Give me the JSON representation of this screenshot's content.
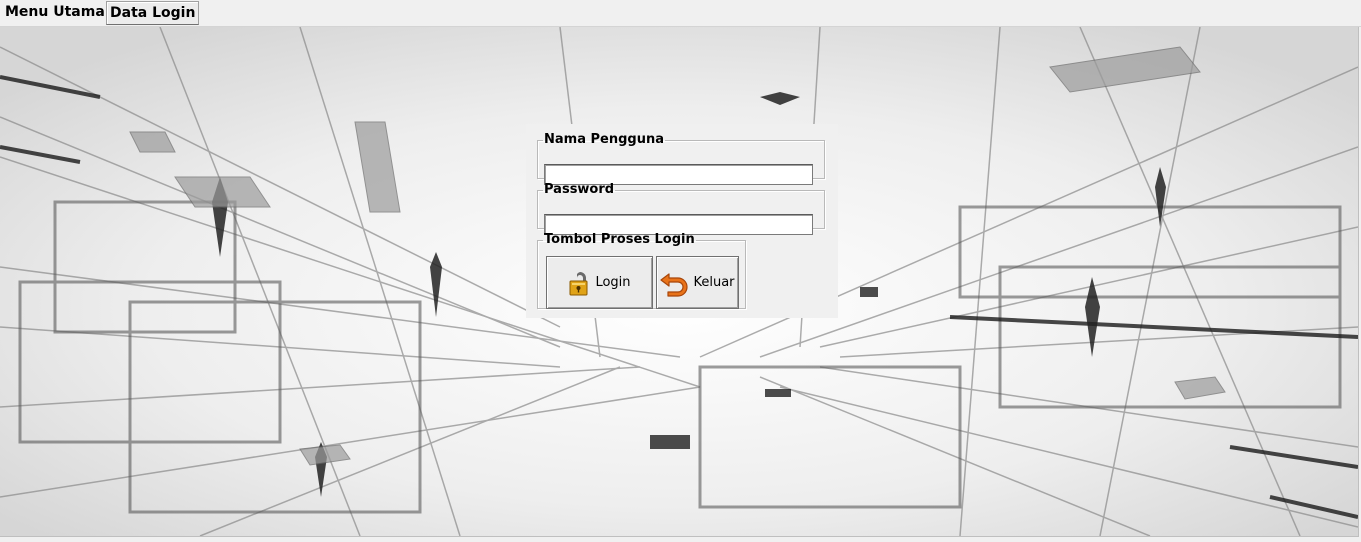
{
  "menu": {
    "items": [
      {
        "label": "Menu Utama"
      },
      {
        "label": "Data Login"
      }
    ]
  },
  "login": {
    "username_group": "Nama Pengguna",
    "username_value": "",
    "password_group": "Password",
    "password_value": "",
    "buttons_group": "Tombol Proses Login",
    "login_button": {
      "label": "Login",
      "icon": "lock-icon"
    },
    "exit_button": {
      "label": "Keluar",
      "icon": "undo-arrow-icon"
    }
  },
  "colors": {
    "window_bg": "#f0f0f0",
    "exit_icon": "#e8731a",
    "lock_icon": "#e0a317"
  }
}
